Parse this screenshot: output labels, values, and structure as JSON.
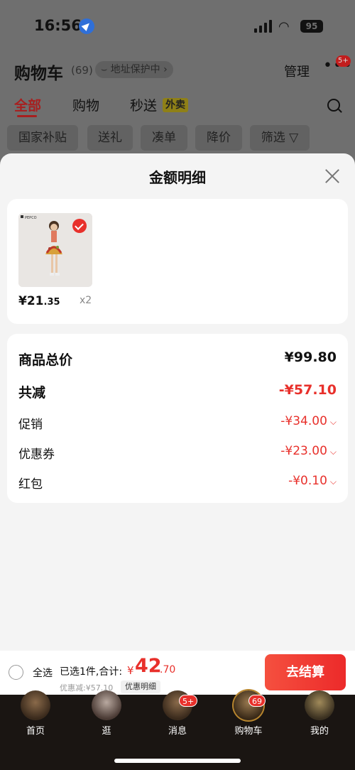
{
  "status_bar": {
    "time": "16:56",
    "battery": "95"
  },
  "header": {
    "title": "购物车",
    "count": "(69)",
    "address": "⌣ 地址保护中 ›",
    "manage": "管理",
    "more": "•••",
    "more_badge": "5+"
  },
  "tabs": [
    {
      "label": "全部",
      "active": true
    },
    {
      "label": "购物",
      "active": false
    },
    {
      "label": "秒送",
      "active": false
    }
  ],
  "takeout_tag": "外卖",
  "chips": [
    "国家补贴",
    "送礼",
    "凑单",
    "降价",
    "筛选 ▽"
  ],
  "sheet": {
    "title": "金额明细",
    "product": {
      "price_int": "¥21",
      "price_dec": ".35",
      "qty": "x2",
      "brand": "PEPCO"
    },
    "rows": {
      "total_label": "商品总价",
      "total_value": "¥99.80",
      "reduce_label": "共减",
      "reduce_value": "-¥57.10",
      "promo_label": "促销",
      "promo_value": "-¥34.00",
      "coupon_label": "优惠券",
      "coupon_value": "-¥23.00",
      "redpacket_label": "红包",
      "redpacket_value": "-¥0.10"
    }
  },
  "checkout": {
    "select_all": "全选",
    "selected_text": "已选1件,合计:",
    "total_symbol": "¥",
    "total_int": "42",
    "total_dec": ".70",
    "discount_text": "优惠减:¥57.10",
    "detail_btn": "优惠明细",
    "checkout_btn": "去结算"
  },
  "tabbar": [
    {
      "label": "首页",
      "badge": ""
    },
    {
      "label": "逛",
      "badge": ""
    },
    {
      "label": "消息",
      "badge": "5+"
    },
    {
      "label": "购物车",
      "badge": "69"
    },
    {
      "label": "我的",
      "badge": ""
    }
  ],
  "colors": {
    "accent_red": "#e8302b",
    "dim_bg": "#6f6f6f"
  }
}
